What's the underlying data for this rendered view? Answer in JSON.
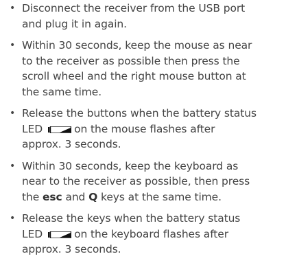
{
  "instructions": [
    {
      "bullet": "•",
      "lines": [
        "Disconnect the receiver from the USB port",
        "and plug it in again."
      ]
    },
    {
      "bullet": "•",
      "lines": [
        "Within 30 seconds, keep the mouse as near",
        "to the receiver as possible then press the",
        "scroll wheel and the right mouse button at",
        "the same time."
      ]
    },
    {
      "bullet": "•",
      "line1_pre": "Release the buttons when the battery status",
      "line2_pre": "LED",
      "line2_post": "on the mouse flashes after",
      "line3": "approx. 3 seconds.",
      "led_icon": "battery-status-led-icon"
    },
    {
      "bullet": "•",
      "line1": "Within 30 seconds, keep the keyboard as",
      "line2": "near to the receiver as possible, then press",
      "line3_pre": "the",
      "key1": "esc",
      "line3_mid": "and",
      "key2": "Q",
      "line3_post": "keys at the same time."
    },
    {
      "bullet": "•",
      "line1_pre": "Release the keys when the battery status",
      "line2_pre": "LED",
      "line2_post": "on the keyboard flashes after",
      "line3": "approx. 3 seconds.",
      "led_icon": "battery-status-led-icon"
    }
  ],
  "colors": {
    "text": "#444444",
    "led": "#111111"
  }
}
